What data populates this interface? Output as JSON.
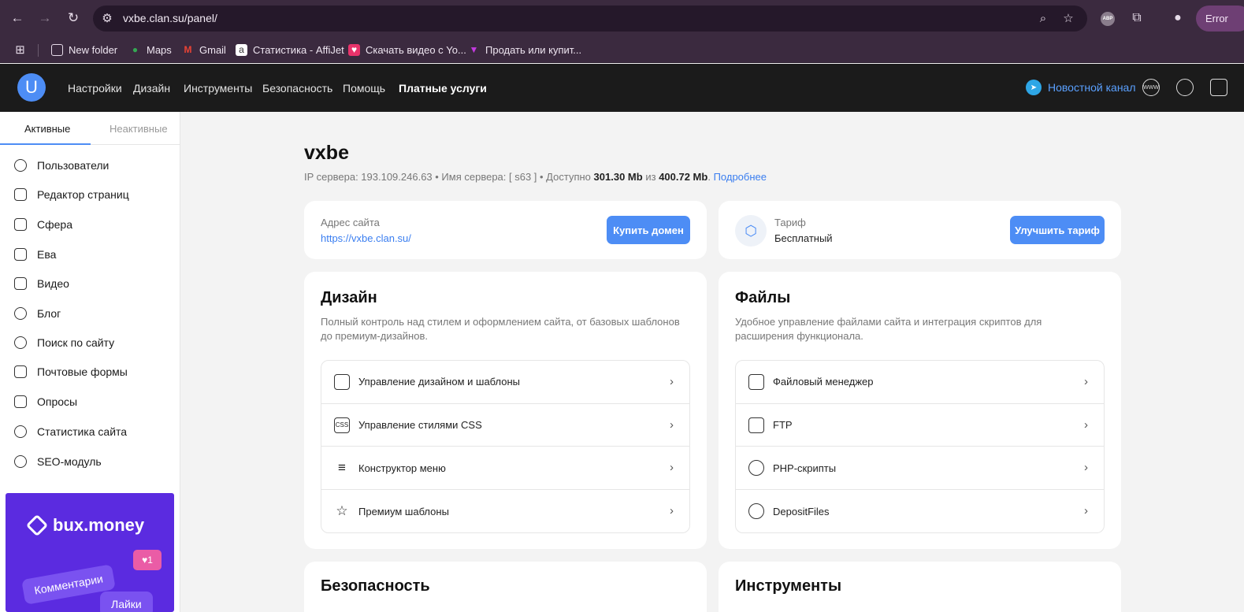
{
  "browser": {
    "url": "vxbe.clan.su/panel/",
    "error_label": "Error",
    "abp_label": "ABP",
    "bookmarks": [
      "New folder",
      "Maps",
      "Gmail",
      "Статистика - AffiJet",
      "Скачать видео с Yo...",
      "Продать или купит..."
    ]
  },
  "header": {
    "logo_letter": "U",
    "nav": [
      "Настройки",
      "Дизайн",
      "Инструменты",
      "Безопасность",
      "Помощь",
      "Платные услуги"
    ],
    "news_channel": "Новостной канал",
    "www_label": "WWW"
  },
  "sidebar": {
    "tabs": [
      "Активные",
      "Неактивные"
    ],
    "items": [
      "Пользователи",
      "Редактор страниц",
      "Сфера",
      "Ева",
      "Видео",
      "Блог",
      "Поиск по сайту",
      "Почтовые формы",
      "Опросы",
      "Статистика сайта",
      "SEO-модуль"
    ],
    "promo": {
      "brand": "bux.money",
      "pill1": "Комментарии",
      "pill2": "Лайки",
      "heart_count": "1"
    }
  },
  "site": {
    "name": "vxbe",
    "info_prefix": "IP сервера: 193.109.246.63 • Имя сервера: [ s63 ] • Доступно",
    "available": "301.30 Mb",
    "of": "из",
    "total": "400.72 Mb",
    "more_link": "Подробнее"
  },
  "address_card": {
    "label": "Адрес сайта",
    "url": "https://vxbe.clan.su/",
    "button": "Купить домен"
  },
  "tariff_card": {
    "label": "Тариф",
    "value": "Бесплатный",
    "button": "Улучшить тариф"
  },
  "design_card": {
    "title": "Дизайн",
    "desc": "Полный контроль над стилем и оформлением сайта, от базовых шаблонов до премиум-дизайнов.",
    "items": [
      "Управление дизайном и шаблоны",
      "Управление стилями CSS",
      "Конструктор меню",
      "Премиум шаблоны"
    ],
    "css_icon_label": "CSS"
  },
  "files_card": {
    "title": "Файлы",
    "desc": "Удобное управление файлами сайта и интеграция скриптов для расширения функционала.",
    "items": [
      "Файловый менеджер",
      "FTP",
      "PHP-скрипты",
      "DepositFiles"
    ]
  },
  "security_card": {
    "title": "Безопасность"
  },
  "tools_card": {
    "title": "Инструменты"
  }
}
